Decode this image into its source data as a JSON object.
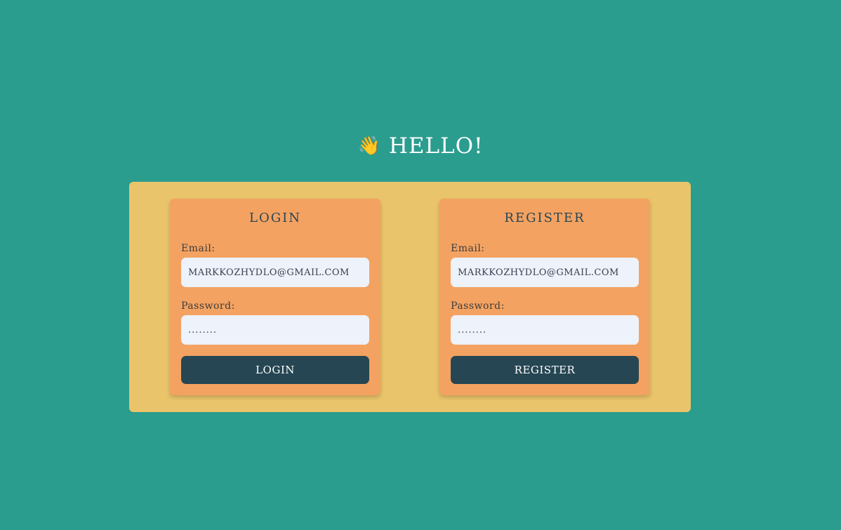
{
  "header": {
    "icon": "waving-hand",
    "icon_glyph": "👋",
    "title": "HELLO!"
  },
  "login": {
    "title": "LOGIN",
    "email_label": "Email:",
    "email_value": "MARKKOZHYDLO@GMAIL.COM",
    "password_label": "Password:",
    "password_value": "........",
    "button_label": "LOGIN"
  },
  "register": {
    "title": "REGISTER",
    "email_label": "Email:",
    "email_value": "MARKKOZHYDLO@GMAIL.COM",
    "password_label": "Password:",
    "password_value": "........",
    "button_label": "REGISTER"
  },
  "colors": {
    "background": "#2a9d8f",
    "panel": "#e9c46a",
    "card": "#f4a261",
    "input": "#edf2fb",
    "button": "#264653",
    "text_light": "#ffffff"
  }
}
